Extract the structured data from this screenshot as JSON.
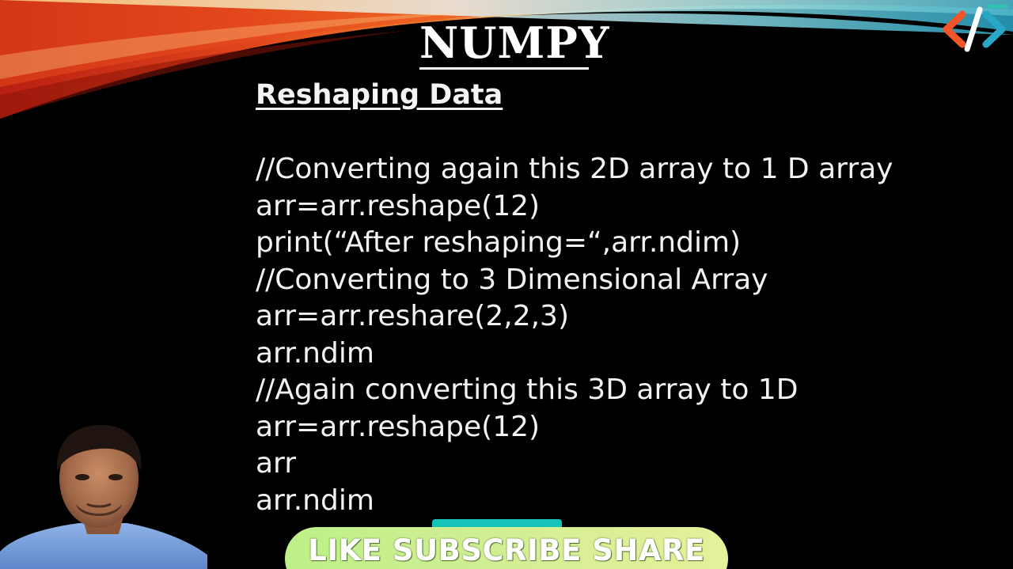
{
  "slide": {
    "title": "NUMPY",
    "subtitle": "Reshaping Data",
    "code_lines": [
      "//Converting again this 2D array to 1 D array",
      "arr=arr.reshape(12)",
      "print(“After reshaping=“,arr.ndim)",
      "//Converting to 3 Dimensional Array",
      "arr=arr.reshare(2,2,3)",
      "arr.ndim",
      "//Again converting this 3D array to 1D",
      "arr=arr.reshape(12)",
      "arr",
      "arr.ndim"
    ]
  },
  "banner": {
    "label": "LIKE SUBSCRIBE SHARE"
  },
  "icons": {
    "logo": "code-brackets-logo-icon",
    "presenter": "presenter-webcam"
  },
  "colors": {
    "background": "#000000",
    "text": "#f2f2f2",
    "banner_start": "#bdf089",
    "banner_end": "#e6f09a",
    "banner_tab": "#17c3b8",
    "swoosh_red": "#d8321b",
    "swoosh_orange": "#f08a2a",
    "swoosh_teal": "#3ab6c9"
  }
}
